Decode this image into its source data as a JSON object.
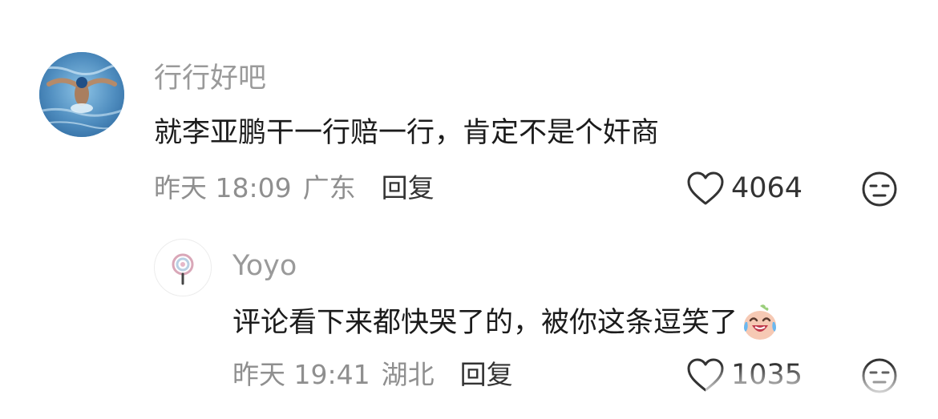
{
  "comments": [
    {
      "username": "行行好吧",
      "text": "就李亚鹏干一行赔一行，肯定不是个奸商",
      "time": "昨天 18:09",
      "location": "广东",
      "reply_label": "回复",
      "likes": "4064",
      "avatar": "swimmer-photo",
      "emoji_icon": "neutral-face-icon"
    },
    {
      "username": "Yoyo",
      "text": "评论看下来都快哭了的，被你这条逗笑了",
      "inline_emoji": "laugh-cry-emoji",
      "time": "昨天 19:41",
      "location": "湖北",
      "reply_label": "回复",
      "likes": "1035",
      "avatar": "lollipop-icon",
      "emoji_icon": "neutral-face-icon"
    }
  ],
  "colors": {
    "username": "#9a9a9a",
    "text": "#1b1b1b",
    "meta": "#8f8f8f",
    "icon": "#333333"
  }
}
